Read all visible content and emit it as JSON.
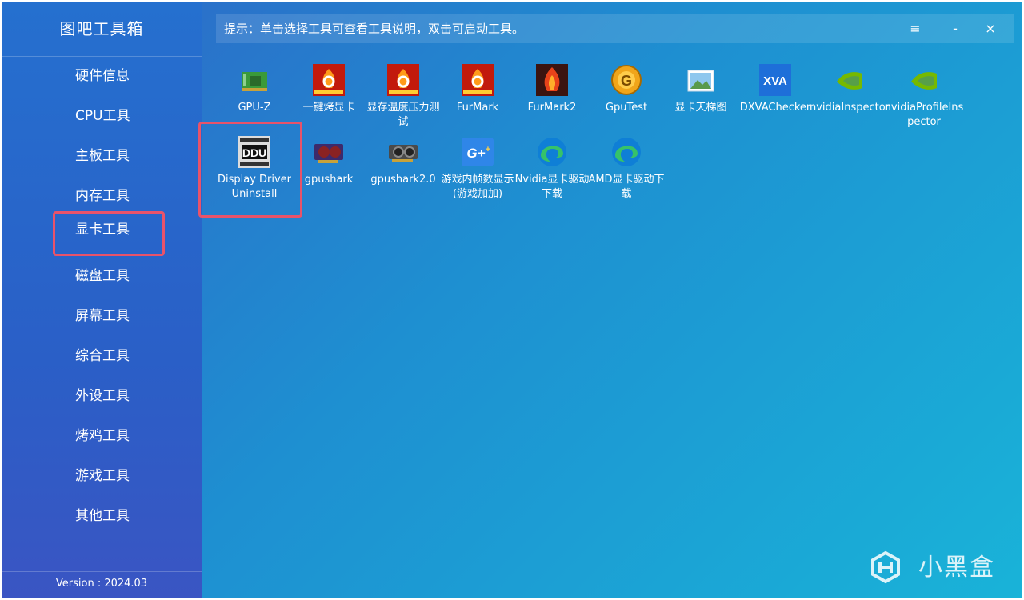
{
  "app": {
    "title": "图吧工具箱",
    "version": "Version : 2024.03"
  },
  "hint": "提示：单击选择工具可查看工具说明，双击可启动工具。",
  "window_controls": {
    "menu": "≡",
    "minimize": "-",
    "close": "×"
  },
  "sidebar": {
    "items": [
      {
        "label": "硬件信息"
      },
      {
        "label": "CPU工具"
      },
      {
        "label": "主板工具"
      },
      {
        "label": "内存工具"
      },
      {
        "label": "显卡工具",
        "active": true
      },
      {
        "label": "磁盘工具"
      },
      {
        "label": "屏幕工具"
      },
      {
        "label": "综合工具"
      },
      {
        "label": "外设工具"
      },
      {
        "label": "烤鸡工具"
      },
      {
        "label": "游戏工具"
      },
      {
        "label": "其他工具"
      }
    ]
  },
  "tools": [
    {
      "label": "GPU-Z",
      "icon": "gpu-card-icon"
    },
    {
      "label": "一键烤显卡",
      "icon": "furmark-icon"
    },
    {
      "label": "显存温度压力测试",
      "icon": "furmark-icon"
    },
    {
      "label": "FurMark",
      "icon": "furmark-icon"
    },
    {
      "label": "FurMark2",
      "icon": "furmark2-icon"
    },
    {
      "label": "GpuTest",
      "icon": "gputest-icon"
    },
    {
      "label": "显卡天梯图",
      "icon": "picture-icon"
    },
    {
      "label": "DXVAChecker",
      "icon": "xva-icon"
    },
    {
      "label": "nvidiaInspector",
      "icon": "nvidia-icon"
    },
    {
      "label": "nvidiaProfileInspector",
      "icon": "nvidia-icon"
    },
    {
      "label": "Display Driver Uninstall",
      "icon": "ddu-icon",
      "highlighted": true
    },
    {
      "label": "gpushark",
      "icon": "graphics-card-icon"
    },
    {
      "label": "gpushark2.0",
      "icon": "graphics-card-icon"
    },
    {
      "label": "游戏内帧数显示(游戏加加)",
      "icon": "gplus-icon"
    },
    {
      "label": "Nvidia显卡驱动下载",
      "icon": "edge-icon"
    },
    {
      "label": "AMD显卡驱动下载",
      "icon": "edge-icon"
    }
  ],
  "watermark": "小黑盒",
  "colors": {
    "accent_highlight": "#e8536a",
    "furmark_red": "#c21a0c",
    "nvidia_green": "#76b900"
  }
}
